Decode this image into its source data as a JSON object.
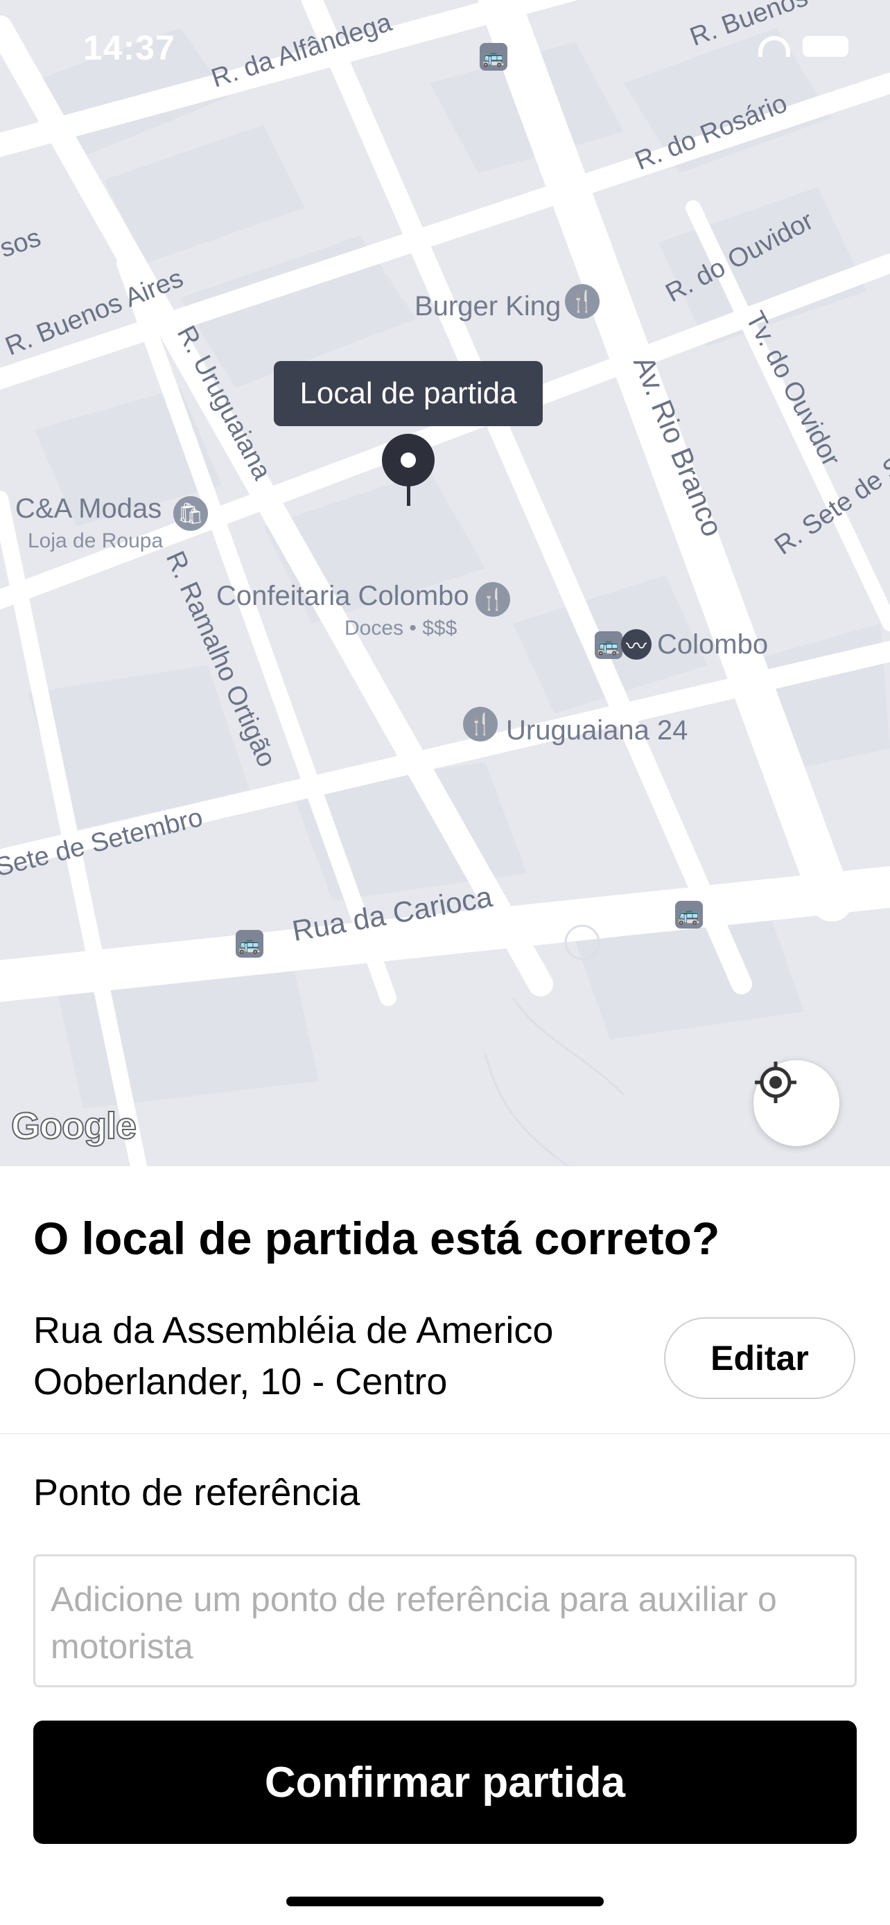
{
  "status_bar": {
    "time": "14:37"
  },
  "map": {
    "tooltip": "Local de partida",
    "google_logo": "Google",
    "streets": [
      "R. da Alfândega",
      "R. Buenos",
      "R. do Rosário",
      "R. do Ouvidor",
      "Tv. do Ouvidor",
      "R. Sete de Set",
      "Av. Rio Branco",
      "R. Buenos Aires",
      "R. Uruguaiana",
      "R. Ramalho Ortigão",
      "Sete de Setembro",
      "Rua da Carioca",
      "sos"
    ],
    "pois": {
      "burger_king": "Burger King",
      "cea_modas": "C&A Modas",
      "cea_modas_sub": "Loja de Roupa",
      "confeitaria": "Confeitaria Colombo",
      "confeitaria_sub": "Doces • $$$",
      "colombo": "Colombo",
      "uruguaiana24": "Uruguaiana 24"
    }
  },
  "sheet": {
    "title": "O local de partida está correto?",
    "address_line1": "Rua da Assembléia de Americo",
    "address_line2": "Ooberlander, 10 - Centro",
    "edit_label": "Editar",
    "reference_label": "Ponto de referência",
    "reference_placeholder": "Adicione um ponto de referência para auxiliar o motorista",
    "confirm_label": "Confirmar partida"
  }
}
